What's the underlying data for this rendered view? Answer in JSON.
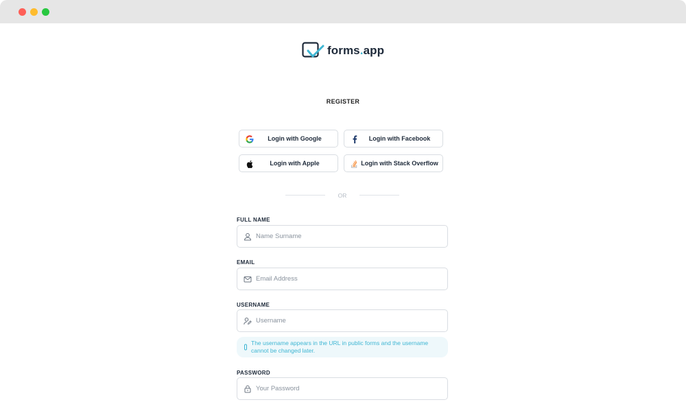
{
  "app": {
    "brand": "forms.app",
    "brand_prefix": "forms",
    "brand_suffix": "app",
    "brand_colors": {
      "dark": "#1e2a3a",
      "accent": "#3fb6d3"
    }
  },
  "window": {
    "controls": [
      "close",
      "minimize",
      "maximize"
    ]
  },
  "page": {
    "heading": "REGISTER"
  },
  "social_logins": [
    {
      "id": "google",
      "label": "Login with Google",
      "icon": "google-icon"
    },
    {
      "id": "facebook",
      "label": "Login with Facebook",
      "icon": "facebook-icon"
    },
    {
      "id": "apple",
      "label": "Login with Apple",
      "icon": "apple-icon"
    },
    {
      "id": "stackoverflow",
      "label": "Login with Stack Overflow",
      "icon": "stack-overflow-icon"
    }
  ],
  "divider": {
    "label": "OR"
  },
  "form": {
    "full_name": {
      "label": "FULL NAME",
      "placeholder": "Name Surname",
      "value": "",
      "icon": "user-icon"
    },
    "email": {
      "label": "EMAIL",
      "placeholder": "Email Address",
      "value": "",
      "icon": "envelope-icon"
    },
    "username": {
      "label": "USERNAME",
      "placeholder": "Username",
      "value": "",
      "icon": "user-edit-icon"
    },
    "username_info": "The username appears in the URL in public forms and the username cannot be changed later.",
    "password": {
      "label": "PASSWORD",
      "placeholder": "Your Password",
      "value": "",
      "icon": "lock-icon"
    }
  }
}
